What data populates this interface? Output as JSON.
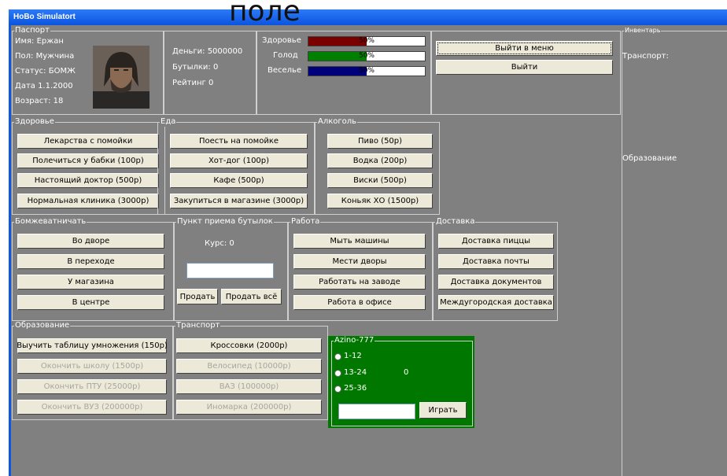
{
  "window": {
    "title": "HoBo Simulatort"
  },
  "overlay_text": "поле",
  "passport": {
    "caption": "Паспорт",
    "name": "Имя:  Ержан",
    "gender": "Пол:  Мужчина",
    "status": "Статус: БОМЖ",
    "date": "Дата  1.1.2000",
    "age": "Возраст: 18"
  },
  "money": {
    "money": "Деньги:  5000000",
    "bottles": "Бутылки: 0",
    "rating": "Рейтинг  0"
  },
  "stats": {
    "health": {
      "label": "Здоровье",
      "value": 50,
      "text": "50%",
      "color": "#7a0000"
    },
    "hunger": {
      "label": "Голод",
      "value": 50,
      "text": "50%",
      "color": "#008000"
    },
    "fun": {
      "label": "Веселье",
      "value": 50,
      "text": "50%",
      "color": "#00007a"
    }
  },
  "menu": {
    "to_menu": "Выйти в меню",
    "exit": "Выйти"
  },
  "inventory": {
    "caption": "Инвентарь",
    "transport": "Транспорт:",
    "education": "Образование"
  },
  "health_group": {
    "caption": "Здоровье",
    "buttons": [
      "Лекарства с помойки",
      "Полечиться у бабки (100р)",
      "Настоящий доктор (500р)",
      "Нормальная клиника (3000р)"
    ]
  },
  "food_group": {
    "caption": "Еда",
    "buttons": [
      "Поесть на помойке",
      "Хот-дог (100р)",
      "Кафе (500р)",
      "Закупиться в магазине (3000р)"
    ]
  },
  "alcohol_group": {
    "caption": "Алкоголь",
    "buttons": [
      "Пиво (50р)",
      "Водка (200р)",
      "Виски (500р)",
      "Коньяк ХО (1500р)"
    ]
  },
  "beg_group": {
    "caption": "Бомжеватничать",
    "buttons": [
      "Во дворе",
      "В переходе",
      "У магазина",
      "В центре"
    ]
  },
  "bottles_group": {
    "caption": "Пункт приема бутылок",
    "rate": "Курс:  0",
    "sell": "Продать",
    "sell_all": "Продать всё"
  },
  "work_group": {
    "caption": "Работа",
    "buttons": [
      "Мыть машины",
      "Мести дворы",
      "Работать на заводе",
      "Работа в офисе"
    ]
  },
  "delivery_group": {
    "caption": "Доставка",
    "buttons": [
      "Доставка пиццы",
      "Доставка почты",
      "Доставка документов",
      "Междугородская доставка"
    ]
  },
  "education_group": {
    "caption": "Образование",
    "buttons": [
      "Выучить таблицу умножения (150р)",
      "Окончить школу (1500р)",
      "Окончить ПТУ (25000р)",
      "Окончить ВУЗ (200000р)"
    ]
  },
  "transport_group": {
    "caption": "Транспорт",
    "buttons": [
      "Кроссовки (2000р)",
      "Велосипед (10000р)",
      "ВАЗ (100000р)",
      "Иномарка (200000р)"
    ]
  },
  "casino": {
    "caption": "Azino-777",
    "options": [
      "1-12",
      "13-24",
      "25-36"
    ],
    "result": "0",
    "play": "Играть"
  }
}
